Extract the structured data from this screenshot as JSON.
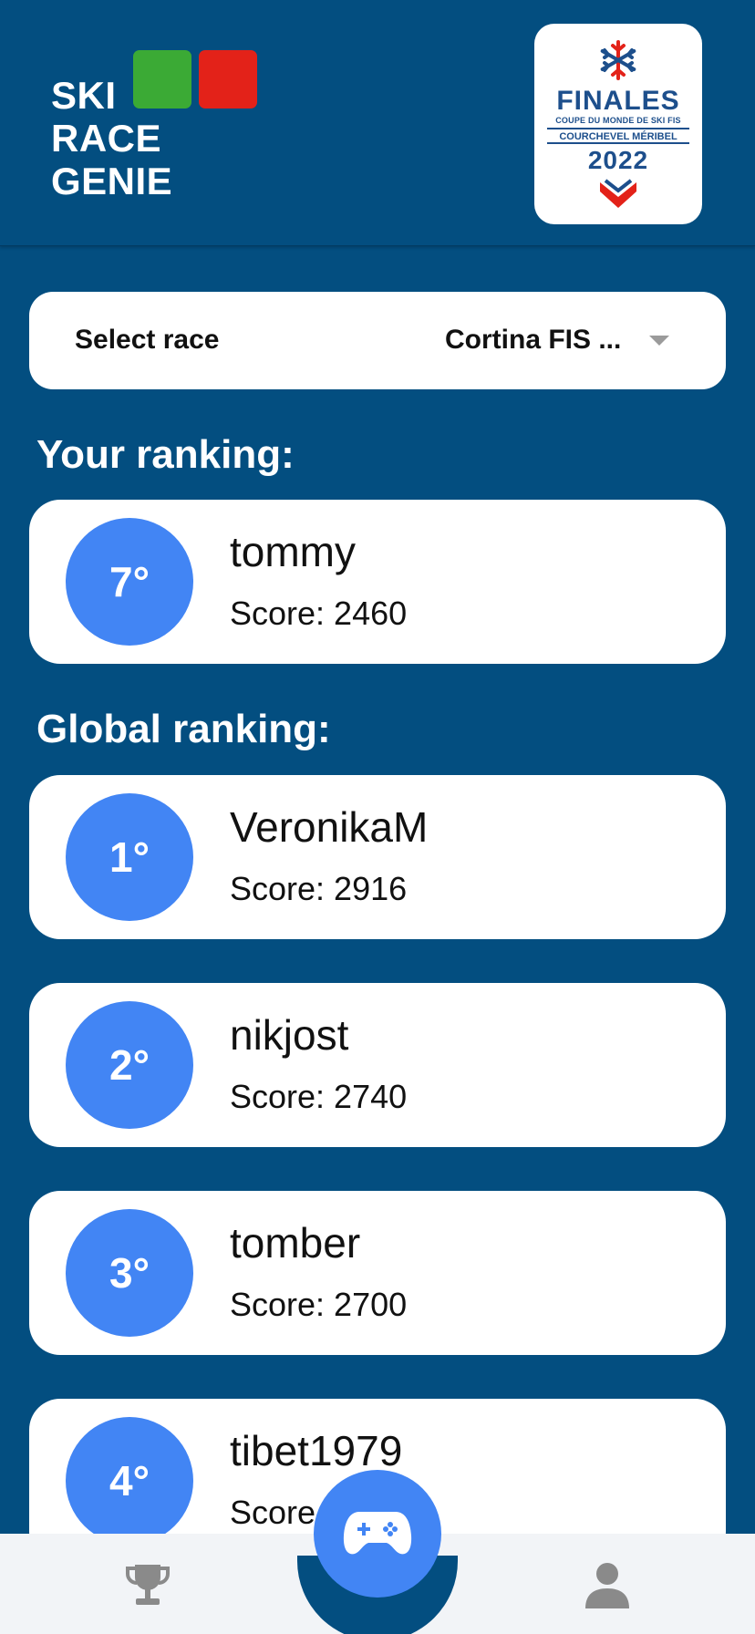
{
  "logo": {
    "line1": "SKI",
    "line2": "RACE",
    "line3": "GENIE",
    "colors": {
      "green": "#3BAA35",
      "red": "#E32219"
    }
  },
  "event_badge": {
    "title": "FINALES",
    "subtitle": "COUPE DU MONDE DE SKI FIS",
    "place": "COURCHEVEL MÉRIBEL",
    "year": "2022",
    "icon": "snowflake-icon"
  },
  "race_select": {
    "label": "Select race",
    "value": "Cortina FIS ..."
  },
  "your_ranking": {
    "title": "Your ranking:",
    "entry": {
      "position": "7°",
      "name": "tommy",
      "score_label": "Score: ",
      "score": "2460"
    }
  },
  "global_ranking": {
    "title": "Global ranking:",
    "entries": [
      {
        "position": "1°",
        "name": "VeronikaM",
        "score_label": "Score: ",
        "score": "2916"
      },
      {
        "position": "2°",
        "name": "nikjost",
        "score_label": "Score: ",
        "score": "2740"
      },
      {
        "position": "3°",
        "name": "tomber",
        "score_label": "Score: ",
        "score": "2700"
      },
      {
        "position": "4°",
        "name": "tibet1979",
        "score_label": "Score",
        "score": ""
      }
    ]
  },
  "bottom_nav": {
    "items": [
      "trophy-icon",
      "gamepad-icon",
      "person-icon"
    ],
    "active": "gamepad-icon"
  },
  "colors": {
    "background": "#034E80",
    "accent": "#4285F4",
    "card": "#FFFFFF",
    "nav": "#F2F4F7"
  }
}
